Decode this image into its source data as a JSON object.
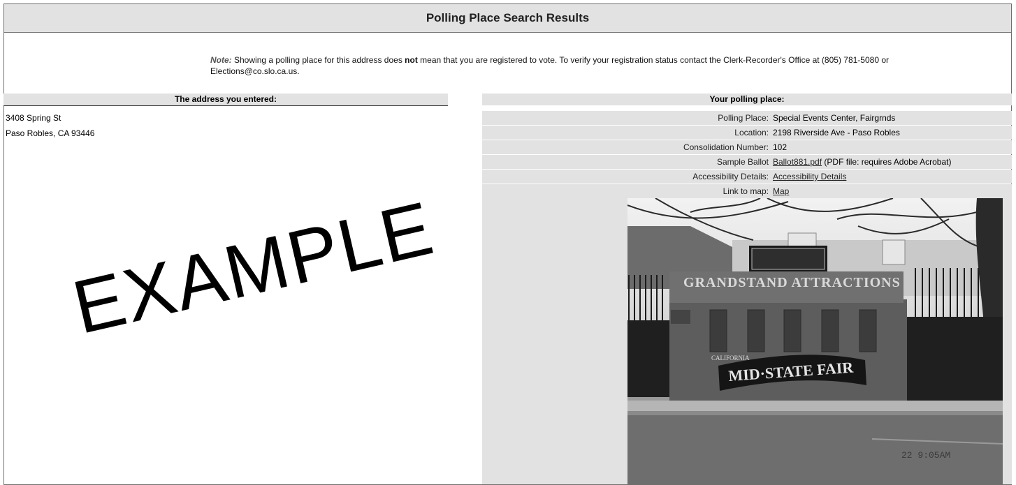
{
  "page": {
    "title": "Polling Place Search Results"
  },
  "note": {
    "label": "Note:",
    "text_before": " Showing a polling place for this address does ",
    "bold": "not",
    "text_after": " mean that you are registered to vote. To verify your registration status contact the Clerk-Recorder's Office at (805) 781-5080 or Elections@co.slo.ca.us."
  },
  "address": {
    "header": "The address you entered:",
    "line1": "3408 Spring St",
    "line2": "Paso Robles, CA 93446"
  },
  "polling": {
    "header": "Your polling place:",
    "rows": [
      {
        "label": "Polling Place:",
        "value": "Special Events Center, Fairgrnds"
      },
      {
        "label": "Location:",
        "value": "2198 Riverside Ave - Paso Robles"
      },
      {
        "label": "Consolidation Number:",
        "value": "102"
      },
      {
        "label": "Sample Ballot",
        "link": "Ballot881.pdf",
        "suffix": " (PDF file: requires Adobe Acrobat)"
      },
      {
        "label": "Accessibility Details:",
        "link": "Accessibility Details"
      },
      {
        "label": "Link to map:",
        "link": "Map"
      }
    ]
  },
  "photo": {
    "sign_top": "GRANDSTAND ATTRACTIONS",
    "sign_small": "CALIFORNIA",
    "sign_main": "MID·STATE FAIR",
    "timestamp": "22  9:05AM"
  },
  "watermark": "EXAMPLE"
}
